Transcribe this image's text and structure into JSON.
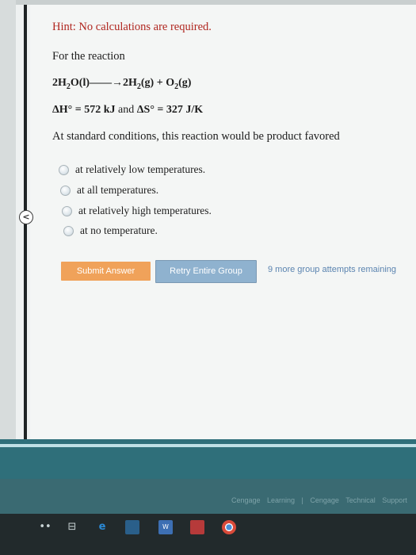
{
  "hint": "Hint: No calculations are required.",
  "intro": "For the reaction",
  "equation": {
    "lhs_coef": "2H",
    "lhs_sub": "2",
    "lhs_rest": "O(l)",
    "arrow": "——→",
    "rhs_coef": "2H",
    "rhs_sub": "2",
    "rhs_mid": "(g) + O",
    "rhs_sub2": "2",
    "rhs_end": "(g)"
  },
  "thermo": {
    "dh": "ΔH° = 572 kJ",
    "and": " and ",
    "ds": "ΔS° = 327 J/K"
  },
  "question": "At standard conditions, this reaction would be product favored",
  "options": [
    "at relatively low temperatures.",
    "at all temperatures.",
    "at relatively high temperatures.",
    "at no temperature."
  ],
  "buttons": {
    "submit": "Submit Answer",
    "retry": "Retry Entire Group"
  },
  "remaining": "9 more group attempts remaining",
  "collapse_glyph": "<",
  "footer": {
    "links": "Cengage Learning | Cengage Technical Support"
  },
  "taskbar": {
    "dots": "••",
    "taskview": "⊟",
    "edge": "e",
    "word": "W"
  },
  "colors": {
    "hint": "#b0261f",
    "submit_bg": "#f0a25a",
    "retry_bg": "#8fb2cf",
    "remaining": "#5b84b0",
    "footer_bg": "#2f6f7a"
  }
}
